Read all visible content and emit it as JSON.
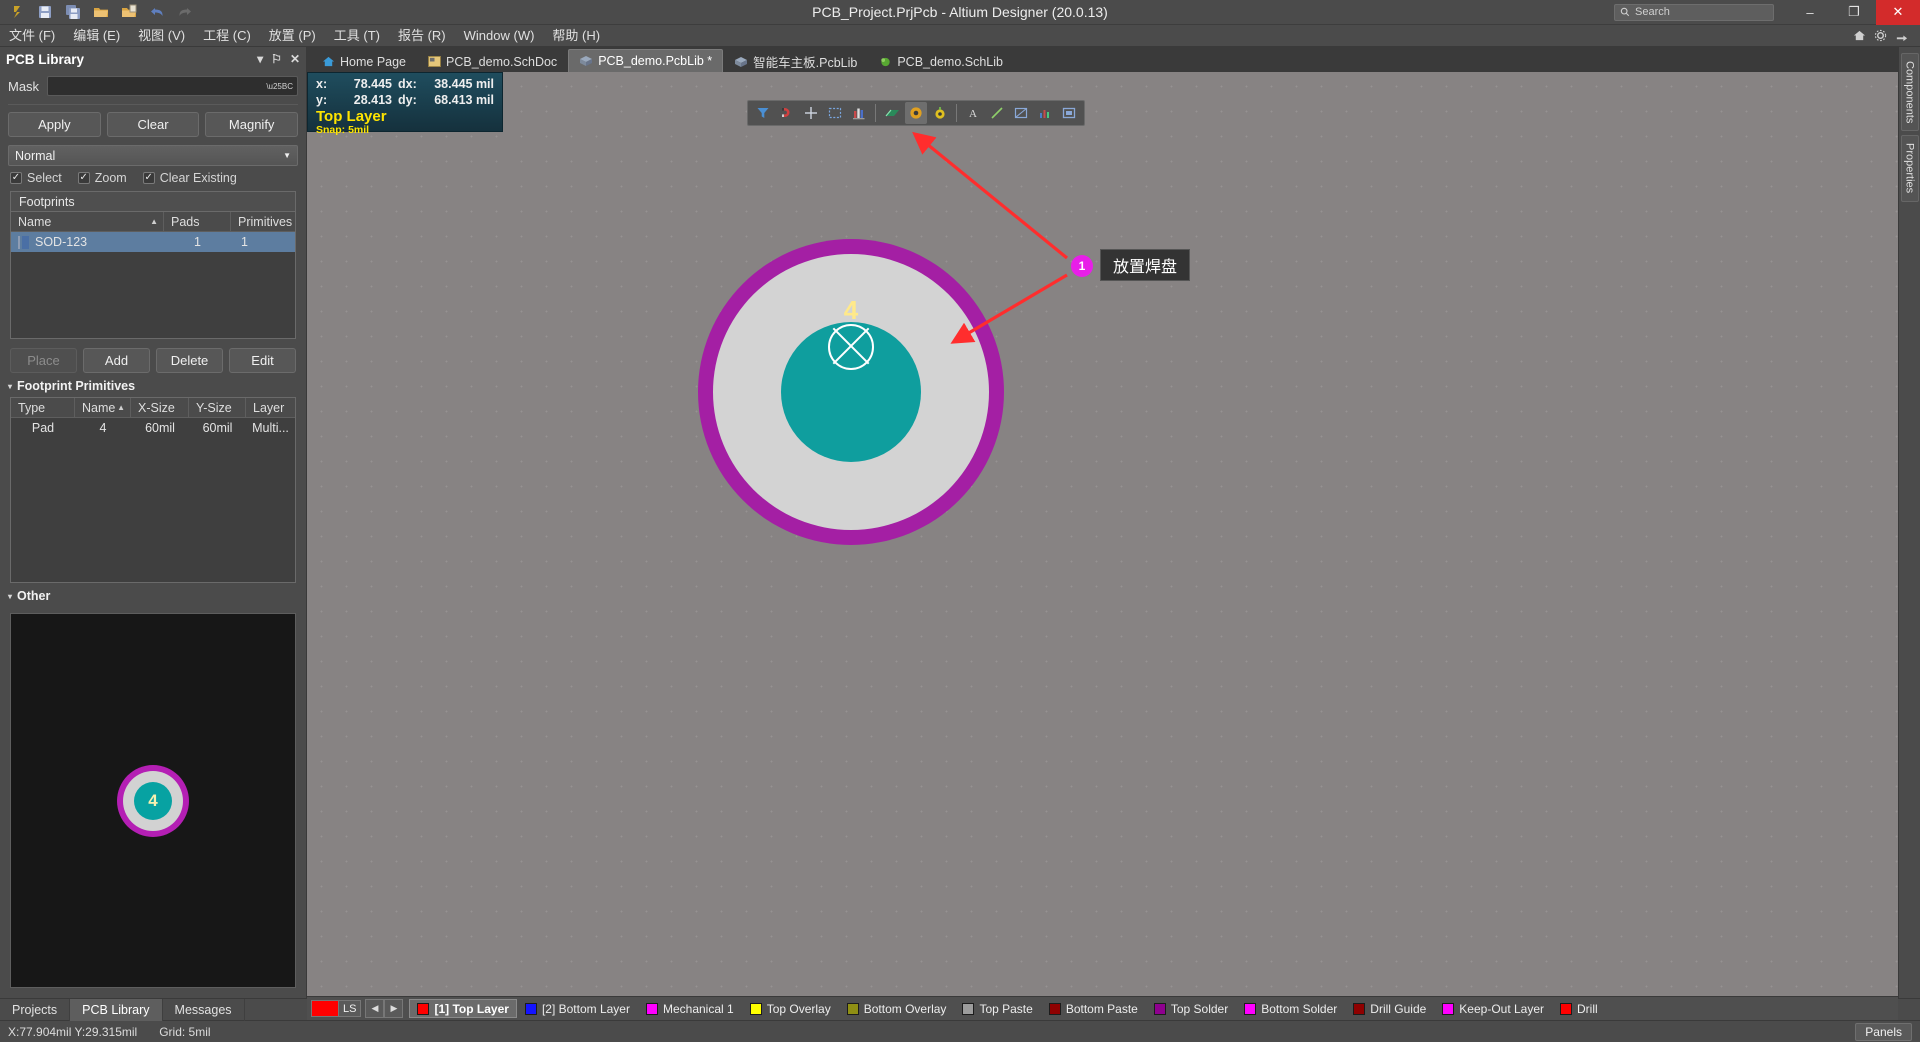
{
  "window": {
    "title": "PCB_Project.PrjPcb - Altium Designer (20.0.13)",
    "search_placeholder": "Search",
    "minimize": "–",
    "maximize": "❐",
    "close": "✕"
  },
  "quick_access": [
    {
      "name": "altium-logo-icon",
      "glyph": "ɑ"
    },
    {
      "name": "save-icon",
      "glyph": "ὋE"
    },
    {
      "name": "save-all-icon",
      "glyph": "ὋE"
    },
    {
      "name": "open-icon",
      "glyph": "Ὄ1"
    },
    {
      "name": "open-project-icon",
      "glyph": "Ὄ1"
    },
    {
      "name": "undo-icon",
      "glyph": "↶"
    },
    {
      "name": "redo-icon",
      "glyph": "↷"
    }
  ],
  "menu": {
    "items": [
      {
        "label": "文件 (F)",
        "name": "menu-file"
      },
      {
        "label": "编辑 (E)",
        "name": "menu-edit"
      },
      {
        "label": "视图 (V)",
        "name": "menu-view"
      },
      {
        "label": "工程 (C)",
        "name": "menu-project"
      },
      {
        "label": "放置 (P)",
        "name": "menu-place"
      },
      {
        "label": "工具 (T)",
        "name": "menu-tools"
      },
      {
        "label": "报告 (R)",
        "name": "menu-reports"
      },
      {
        "label": "Window (W)",
        "name": "menu-window"
      },
      {
        "label": "帮助 (H)",
        "name": "menu-help"
      }
    ],
    "right_icons": [
      {
        "name": "home-icon",
        "glyph": "⌂"
      },
      {
        "name": "gear-icon",
        "glyph": "⚙"
      },
      {
        "name": "user-icon",
        "glyph": "↪"
      }
    ]
  },
  "pcb_library_panel": {
    "title": "PCB Library",
    "controls": [
      {
        "name": "panel-dropdown-icon",
        "glyph": "▾"
      },
      {
        "name": "panel-pin-icon",
        "glyph": "⚐"
      },
      {
        "name": "panel-close-icon",
        "glyph": "✕"
      }
    ],
    "mask_label": "Mask",
    "mask_value": "",
    "buttons": {
      "apply": "Apply",
      "clear": "Clear",
      "magnify": "Magnify"
    },
    "mode_value": "Normal",
    "checkboxes": [
      {
        "label": "Select",
        "checked": true,
        "name": "checkbox-select"
      },
      {
        "label": "Zoom",
        "checked": true,
        "name": "checkbox-zoom"
      },
      {
        "label": "Clear Existing",
        "checked": true,
        "name": "checkbox-clear-existing"
      }
    ],
    "footprints": {
      "title": "Footprints",
      "columns": [
        "Name",
        "Pads",
        "Primitives"
      ],
      "sort_column": "Name",
      "rows": [
        {
          "name": "SOD-123",
          "pads": "1",
          "primitives": "1",
          "selected": true
        }
      ]
    },
    "action_buttons": [
      {
        "label": "Place",
        "name": "place-button",
        "disabled": true
      },
      {
        "label": "Add",
        "name": "add-button",
        "disabled": false
      },
      {
        "label": "Delete",
        "name": "delete-button",
        "disabled": false
      },
      {
        "label": "Edit",
        "name": "edit-button",
        "disabled": false
      }
    ],
    "primitives": {
      "title": "Footprint Primitives",
      "columns": [
        "Type",
        "Name",
        "X-Size",
        "Y-Size",
        "Layer"
      ],
      "sort_column": "Name",
      "rows": [
        {
          "type": "Pad",
          "name": "4",
          "xsize": "60mil",
          "ysize": "60mil",
          "layer": "Multi..."
        }
      ]
    },
    "other": {
      "title": "Other",
      "preview_pad_number": "4"
    }
  },
  "tabs": [
    {
      "label": "Home Page",
      "icon": "home-icon",
      "active": false
    },
    {
      "label": "PCB_demo.SchDoc",
      "icon": "schematic-icon",
      "active": false
    },
    {
      "label": "PCB_demo.PcbLib *",
      "icon": "pcblib-icon",
      "active": true
    },
    {
      "label": "智能车主板.PcbLib",
      "icon": "pcblib-icon",
      "active": false
    },
    {
      "label": "PCB_demo.SchLib",
      "icon": "schlib-icon",
      "active": false
    }
  ],
  "coordinate_readout": {
    "x_label": "x:",
    "x_value": "78.445",
    "dx_label": "dx:",
    "dx_value": "38.445 mil",
    "y_label": "y:",
    "y_value": "28.413",
    "dy_label": "dy:",
    "dy_value": "68.413 mil",
    "layer": "Top Layer",
    "snap": "Snap: 5mil"
  },
  "floating_toolbar": [
    {
      "name": "filter-icon",
      "title": "Filter"
    },
    {
      "name": "magnet-snap-icon",
      "title": "Snap"
    },
    {
      "name": "crosshair-icon",
      "title": "Cursor"
    },
    {
      "name": "selection-box-icon",
      "title": "Select"
    },
    {
      "name": "layer-stack-icon",
      "title": "Layers"
    },
    {
      "sep": true
    },
    {
      "name": "track-icon",
      "title": "Place Track"
    },
    {
      "name": "pad-icon",
      "title": "Place Pad",
      "highlight": true
    },
    {
      "name": "via-icon",
      "title": "Place Via"
    },
    {
      "sep": true
    },
    {
      "name": "text-icon",
      "title": "Place String"
    },
    {
      "name": "line-icon",
      "title": "Place Line"
    },
    {
      "name": "region-icon",
      "title": "Place Region"
    },
    {
      "name": "dimension-icon",
      "title": "Place Dimension"
    },
    {
      "name": "fill-icon",
      "title": "Place Fill"
    }
  ],
  "canvas": {
    "pad_number": "4"
  },
  "annotation": {
    "badge": "1",
    "label": "放置焊盘"
  },
  "right_rail": [
    {
      "label": "Components",
      "name": "rail-tab-components"
    },
    {
      "label": "Properties",
      "name": "rail-tab-properties"
    }
  ],
  "bottom_tabs": [
    {
      "label": "Projects",
      "active": false,
      "name": "bottom-tab-projects"
    },
    {
      "label": "PCB Library",
      "active": true,
      "name": "bottom-tab-pcb-library"
    },
    {
      "label": "Messages",
      "active": false,
      "name": "bottom-tab-messages"
    }
  ],
  "layer_bar": {
    "ls_label": "LS",
    "ls_color": "#ff0000",
    "prev_glyph": "◀",
    "next_glyph": "▶",
    "layers": [
      {
        "label": "[1] Top Layer",
        "color": "#ff0000",
        "active": true
      },
      {
        "label": "[2] Bottom Layer",
        "color": "#1414ff",
        "active": false
      },
      {
        "label": "Mechanical 1",
        "color": "#ff00ff",
        "active": false
      },
      {
        "label": "Top Overlay",
        "color": "#ffff00",
        "active": false
      },
      {
        "label": "Bottom Overlay",
        "color": "#8f8f14",
        "active": false
      },
      {
        "label": "Top Paste",
        "color": "#9c9c9c",
        "active": false
      },
      {
        "label": "Bottom Paste",
        "color": "#8f0000",
        "active": false
      },
      {
        "label": "Top Solder",
        "color": "#8f008f",
        "active": false
      },
      {
        "label": "Bottom Solder",
        "color": "#ff00ff",
        "active": false
      },
      {
        "label": "Drill Guide",
        "color": "#8f0000",
        "active": false
      },
      {
        "label": "Keep-Out Layer",
        "color": "#ff00ff",
        "active": false
      },
      {
        "label": "Drill",
        "color": "#ff0000",
        "active": false
      }
    ]
  },
  "status_bar": {
    "coords": "X:77.904mil Y:29.315mil",
    "grid": "Grid: 5mil",
    "panels_button": "Panels"
  }
}
